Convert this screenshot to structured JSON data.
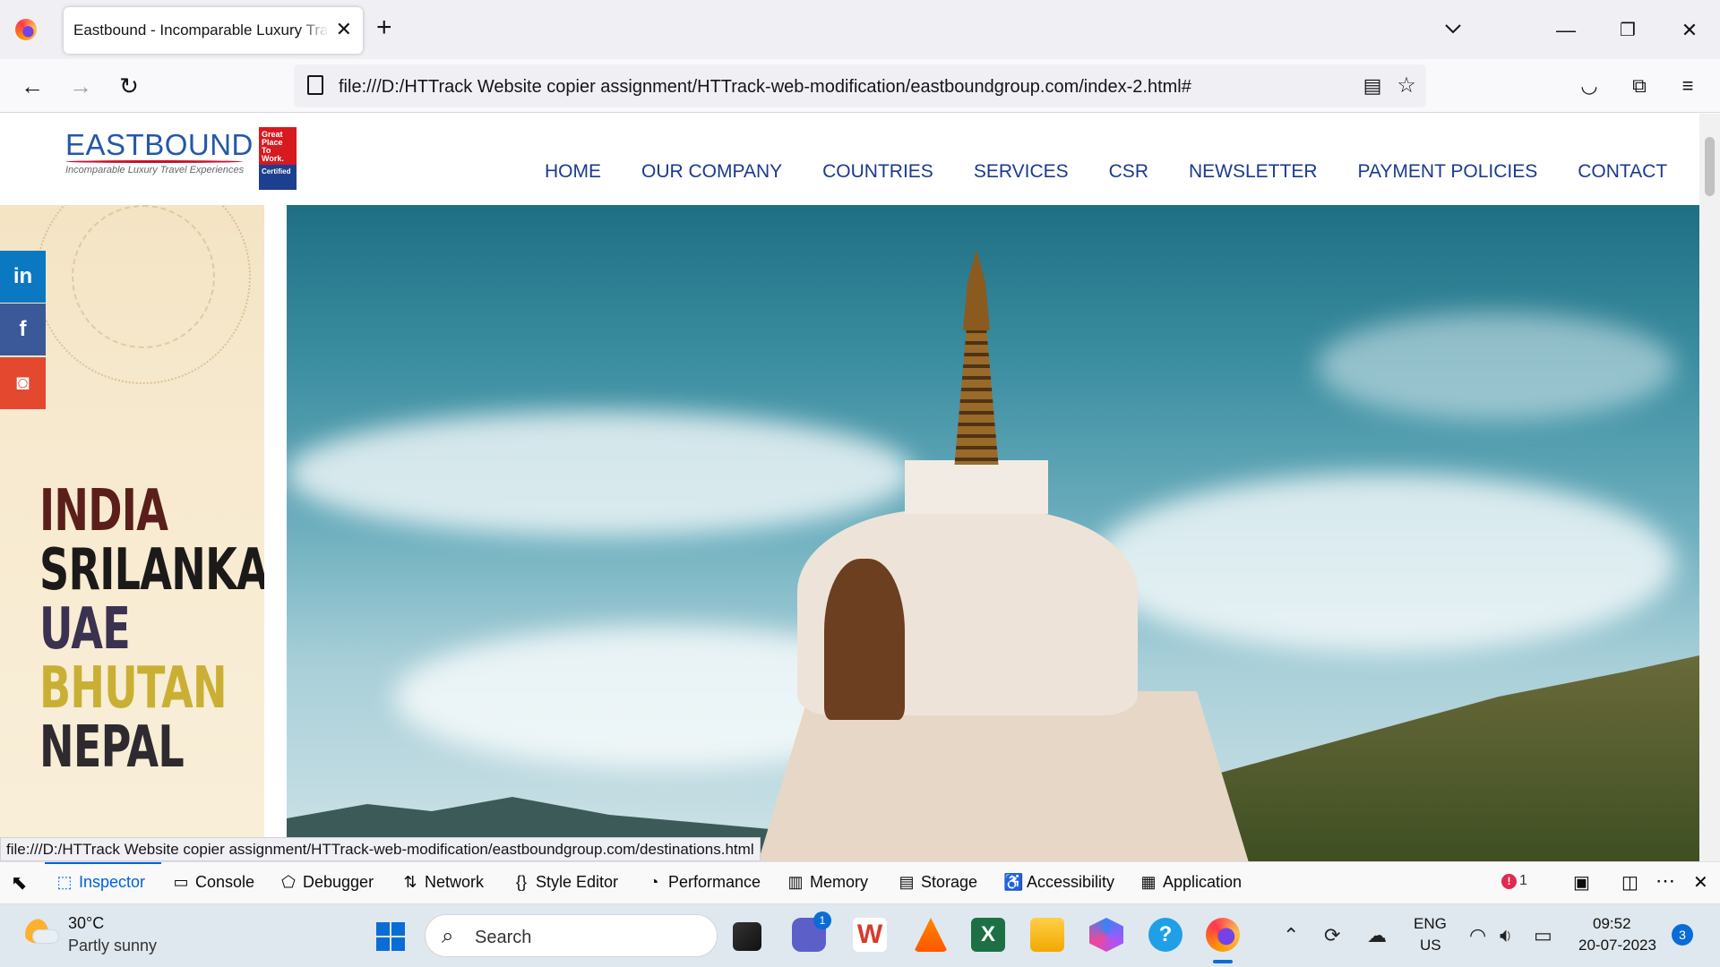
{
  "browser": {
    "tab_title": "Eastbound - Incomparable Luxury Travel Experiences",
    "url": "file:///D:/HTTrack Website copier assignment/HTTrack-web-modification/eastboundgroup.com/index-2.html#",
    "status_url": "file:///D:/HTTrack Website copier assignment/HTTrack-web-modification/eastboundgroup.com/destinations.html"
  },
  "site": {
    "logo_text": "EASTBOUND",
    "logo_tagline": "Incomparable Luxury Travel Experiences",
    "badge": {
      "line1": "Great",
      "line2": "Place",
      "line3": "To",
      "line4": "Work.",
      "certified": "Certified"
    },
    "menu": [
      "HOME",
      "OUR COMPANY",
      "COUNTRIES",
      "SERVICES",
      "CSR",
      "NEWSLETTER",
      "PAYMENT POLICIES",
      "CONTACT"
    ],
    "social": [
      {
        "icon": "linkedin-icon",
        "glyph": "in",
        "color": "#0a79c2"
      },
      {
        "icon": "facebook-icon",
        "glyph": "f",
        "color": "#3b5998"
      },
      {
        "icon": "instagram-icon",
        "glyph": "◙",
        "color": "#e4482f"
      }
    ],
    "destinations": [
      {
        "name": "INDIA",
        "color": "#5a1f1a"
      },
      {
        "name": "SRILANKA",
        "color": "#1c1a18"
      },
      {
        "name": "UAE",
        "color": "#3b3150"
      },
      {
        "name": "BHUTAN",
        "color": "#c9b034"
      },
      {
        "name": "NEPAL",
        "color": "#2e2a2f"
      }
    ]
  },
  "devtools": {
    "tabs": [
      {
        "label": "Inspector",
        "icon": "⬚"
      },
      {
        "label": "Console",
        "icon": "▭"
      },
      {
        "label": "Debugger",
        "icon": "⬠"
      },
      {
        "label": "Network",
        "icon": "⇅"
      },
      {
        "label": "Style Editor",
        "icon": "{}"
      },
      {
        "label": "Performance",
        "icon": "◔"
      },
      {
        "label": "Memory",
        "icon": "▥"
      },
      {
        "label": "Storage",
        "icon": "▤"
      },
      {
        "label": "Accessibility",
        "icon": "♿"
      },
      {
        "label": "Application",
        "icon": "▦"
      }
    ],
    "error_count": "1"
  },
  "taskbar": {
    "weather_temp": "30°C",
    "weather_desc": "Partly sunny",
    "search_placeholder": "Search",
    "lang_line1": "ENG",
    "lang_line2": "US",
    "time": "09:52",
    "date": "20-07-2023",
    "notification_count": "3",
    "teams_badge": "1"
  },
  "colors": {
    "menu": "#1b3a8c",
    "accent_blue": "#0061e0",
    "logo_blue": "#2458a8"
  }
}
